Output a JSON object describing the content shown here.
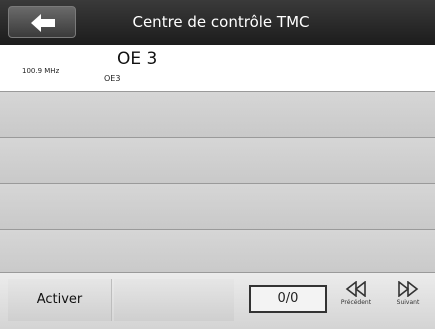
{
  "header": {
    "title": "Centre de contrôle TMC",
    "back_icon": "arrow-left-icon"
  },
  "stations": [
    {
      "frequency": "100.9 MHz",
      "name": "OE 3",
      "code": "OE3",
      "selected": true
    },
    {
      "frequency": "",
      "name": "",
      "code": ""
    },
    {
      "frequency": "",
      "name": "",
      "code": ""
    },
    {
      "frequency": "",
      "name": "",
      "code": ""
    },
    {
      "frequency": "",
      "name": "",
      "code": ""
    }
  ],
  "footer": {
    "activate_label": "Activer",
    "counter": "0/0",
    "previous_label": "Précédent",
    "next_label": "Suivant",
    "previous_icon": "rewind-icon",
    "next_icon": "fast-forward-icon"
  },
  "colors": {
    "header": "#2a2a2a",
    "list_row": "#d0d0d0",
    "selected_row": "#ffffff"
  }
}
